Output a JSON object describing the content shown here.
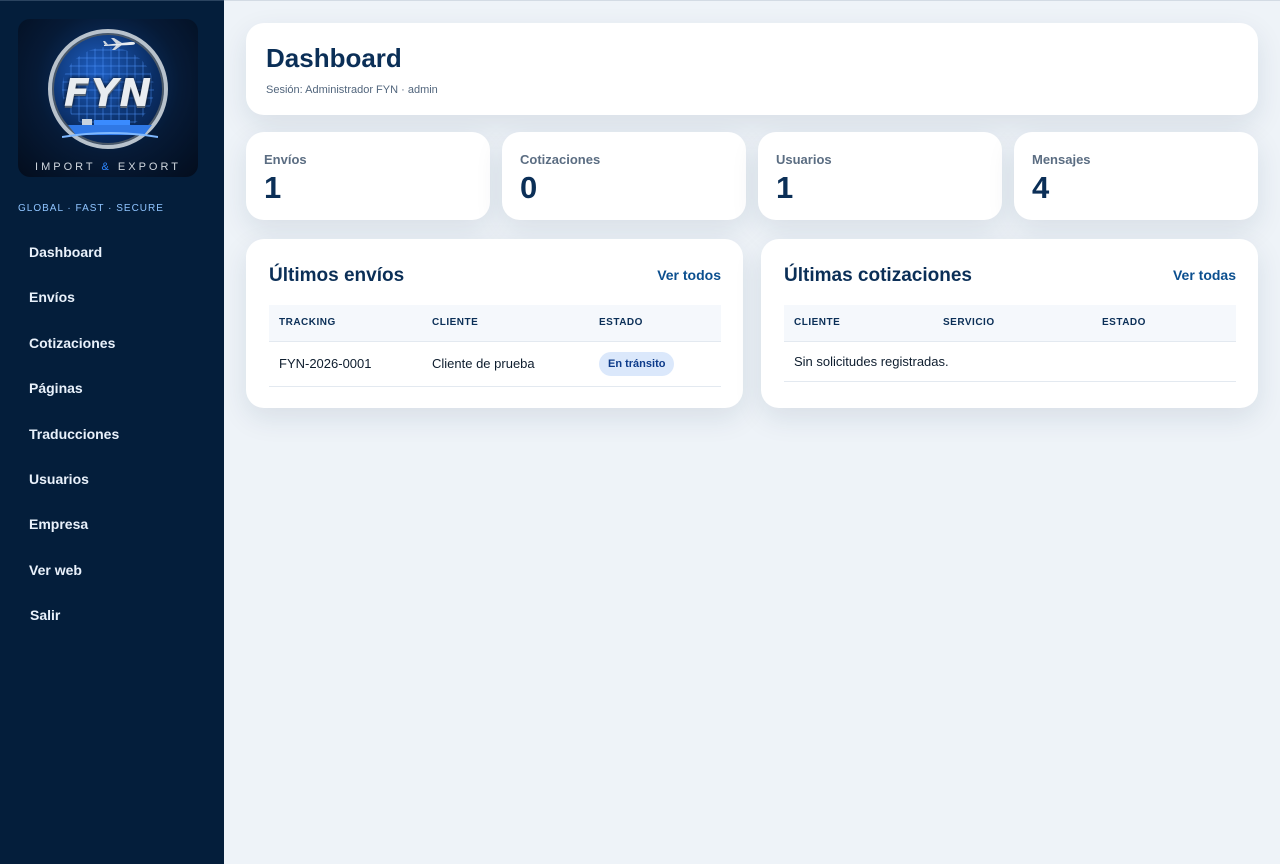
{
  "sidebar": {
    "logo": {
      "letters": "FYN",
      "tagline_left": "IMPORT",
      "tagline_amp": "&",
      "tagline_right": "EXPORT"
    },
    "motto": "GLOBAL · FAST · SECURE",
    "items": [
      {
        "label": "Dashboard"
      },
      {
        "label": "Envíos"
      },
      {
        "label": "Cotizaciones"
      },
      {
        "label": "Páginas"
      },
      {
        "label": "Traducciones"
      },
      {
        "label": "Usuarios"
      },
      {
        "label": "Empresa"
      },
      {
        "label": "Ver web"
      },
      {
        "label": "Salir"
      }
    ]
  },
  "header": {
    "title": "Dashboard",
    "session": "Sesión: Administrador FYN · admin"
  },
  "stats": [
    {
      "label": "Envíos",
      "value": "1"
    },
    {
      "label": "Cotizaciones",
      "value": "0"
    },
    {
      "label": "Usuarios",
      "value": "1"
    },
    {
      "label": "Mensajes",
      "value": "4"
    }
  ],
  "shipments": {
    "title": "Últimos envíos",
    "link": "Ver todos",
    "columns": [
      "TRACKING",
      "CLIENTE",
      "ESTADO"
    ],
    "rows": [
      {
        "tracking": "FYN-2026-0001",
        "client": "Cliente de prueba",
        "status": "En tránsito"
      }
    ]
  },
  "quotes": {
    "title": "Últimas cotizaciones",
    "link": "Ver todas",
    "columns": [
      "CLIENTE",
      "SERVICIO",
      "ESTADO"
    ],
    "empty": "Sin solicitudes registradas."
  },
  "colors": {
    "sidebar_bg": "#041e3b",
    "accent": "#0b2f57",
    "link": "#0b4f8f",
    "badge_bg": "#dbe8fb"
  }
}
